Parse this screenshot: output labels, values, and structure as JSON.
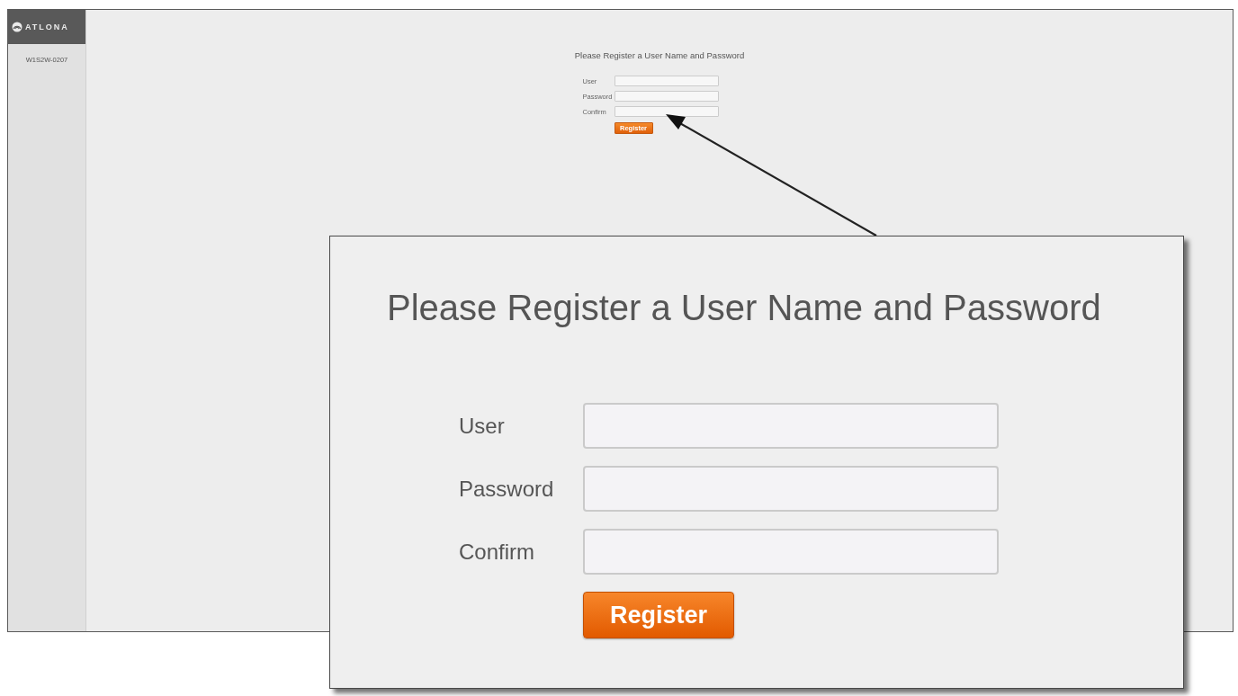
{
  "sidebar": {
    "logo": "ATLONA",
    "device_name": "W1S2W-0207"
  },
  "page": {
    "title": "Please Register a User Name and Password",
    "fields": [
      {
        "label": "User"
      },
      {
        "label": "Password"
      },
      {
        "label": "Confirm"
      }
    ],
    "button": "Register"
  },
  "callout": {
    "title": "Please Register a User Name and Password",
    "fields": [
      {
        "label": "User"
      },
      {
        "label": "Password"
      },
      {
        "label": "Confirm"
      }
    ],
    "button": "Register"
  }
}
